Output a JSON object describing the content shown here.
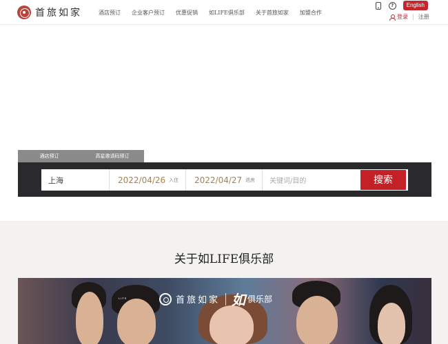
{
  "header": {
    "brand": "首旅如家",
    "nav": [
      "酒店预订",
      "企业客户预订",
      "优惠促销",
      "如LIFE俱乐部",
      "关于首旅如家",
      "加盟合作"
    ],
    "icons": [
      "phone-icon",
      "help-icon"
    ],
    "language_button": "English",
    "login": "登录",
    "separator": "|",
    "register": "注册"
  },
  "booking": {
    "tabs": [
      "酒店预订",
      "高星邀请码预订"
    ],
    "city": "上海",
    "checkin_date": "2022/04/26",
    "checkin_label": "入住",
    "checkout_date": "2022/04/27",
    "checkout_label": "退房",
    "keyword_placeholder": "关键词/目的",
    "search_button": "搜索"
  },
  "club": {
    "title": "关于如LIFE俱乐部",
    "banner_brand": "首旅如家",
    "banner_logo_mark": "如",
    "banner_logo_sub": "LIFE",
    "banner_club": "俱乐部"
  },
  "colors": {
    "brand_red": "#c1272d",
    "date_gold": "#a8804f",
    "panel_dark": "#2a2a2c",
    "tab_gray": "#8a8a8a"
  }
}
